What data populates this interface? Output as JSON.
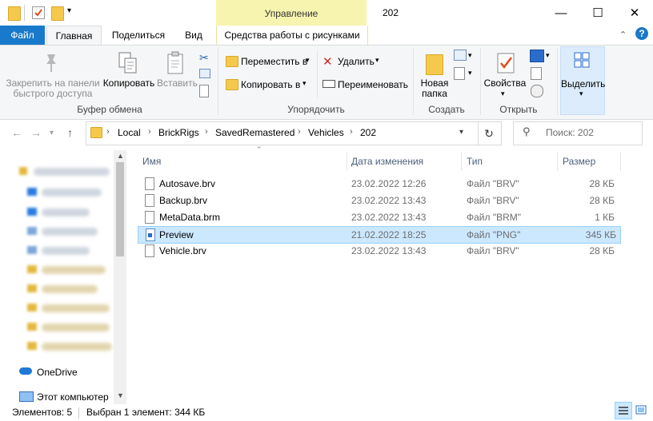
{
  "window": {
    "title": "202",
    "tool_context_title": "Управление",
    "controls": {
      "minimize": "—",
      "maximize": "☐",
      "close": "✕"
    }
  },
  "tabs": {
    "file": "Файл",
    "home": "Главная",
    "share": "Поделиться",
    "view": "Вид",
    "picture_tools": "Средства работы с рисунками"
  },
  "ribbon": {
    "clipboard": {
      "pin_label_1": "Закрепить на панели",
      "pin_label_2": "быстрого доступа",
      "copy": "Копировать",
      "paste": "Вставить",
      "group": "Буфер обмена"
    },
    "organize": {
      "move_to": "Переместить в",
      "copy_to": "Копировать в",
      "delete": "Удалить",
      "rename": "Переименовать",
      "group": "Упорядочить"
    },
    "new": {
      "new_folder_1": "Новая",
      "new_folder_2": "папка",
      "group": "Создать"
    },
    "open": {
      "properties": "Свойства",
      "group": "Открыть"
    },
    "select": {
      "select": "Выделить"
    }
  },
  "address": {
    "crumbs": [
      "Local",
      "BrickRigs",
      "SavedRemastered",
      "Vehicles",
      "202"
    ],
    "search_placeholder": "Поиск: 202"
  },
  "nav": {
    "onedrive": "OneDrive",
    "this_pc": "Этот компьютер"
  },
  "columns": {
    "name": "Имя",
    "date": "Дата изменения",
    "type": "Тип",
    "size": "Размер"
  },
  "files": [
    {
      "name": "Autosave.brv",
      "date": "23.02.2022 12:26",
      "type": "Файл \"BRV\"",
      "size": "28 КБ"
    },
    {
      "name": "Backup.brv",
      "date": "23.02.2022 13:43",
      "type": "Файл \"BRV\"",
      "size": "28 КБ"
    },
    {
      "name": "MetaData.brm",
      "date": "23.02.2022 13:43",
      "type": "Файл \"BRM\"",
      "size": "1 КБ"
    },
    {
      "name": "Preview",
      "date": "21.02.2022 18:25",
      "type": "Файл \"PNG\"",
      "size": "345 КБ"
    },
    {
      "name": "Vehicle.brv",
      "date": "23.02.2022 13:43",
      "type": "Файл \"BRV\"",
      "size": "28 КБ"
    }
  ],
  "status": {
    "count": "Элементов: 5",
    "selected": "Выбран 1 элемент: 344 КБ"
  },
  "colors": {
    "accent": "#1979ca",
    "selection": "#cce8ff",
    "tool_tab": "#f7f4b0"
  }
}
